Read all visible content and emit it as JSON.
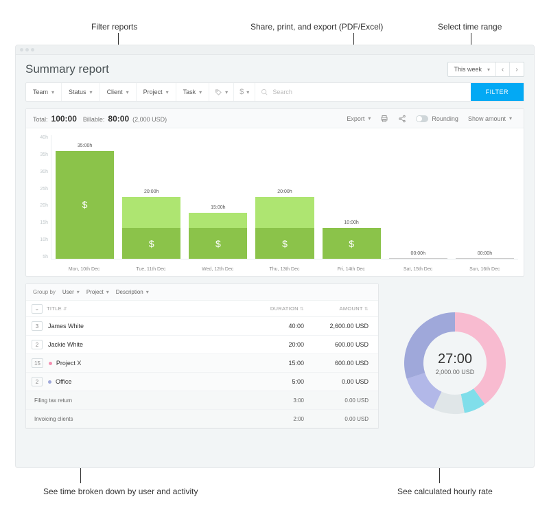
{
  "annotations": {
    "filter": "Filter reports",
    "share": "Share, print, and export (PDF/Excel)",
    "time": "Select time range",
    "breakdown": "See time broken down by user and activity",
    "rate": "See calculated hourly rate"
  },
  "header": {
    "title": "Summary report",
    "time_range": "This week"
  },
  "filters": {
    "team": "Team",
    "status": "Status",
    "client": "Client",
    "project": "Project",
    "task": "Task",
    "search_placeholder": "Search",
    "button": "FILTER"
  },
  "toolbar": {
    "total_label": "Total:",
    "total_value": "100:00",
    "billable_label": "Billable:",
    "billable_value": "80:00",
    "billable_amount": "(2,000 USD)",
    "export": "Export",
    "rounding": "Rounding",
    "show_amount": "Show amount"
  },
  "chart_data": {
    "type": "bar",
    "ylabel_suffix": "h",
    "y_ticks": [
      "40h",
      "35h",
      "30h",
      "25h",
      "20h",
      "15h",
      "10h",
      "5h"
    ],
    "ylim": [
      0,
      40
    ],
    "categories": [
      "Mon, 10th Dec",
      "Tue, 11th Dec",
      "Wed, 12th Dec",
      "Thu, 13th Dec",
      "Fri, 14th Dec",
      "Sat, 15th Dec",
      "Sun, 16th Dec"
    ],
    "series": [
      {
        "name": "non-billable",
        "color": "#aee571",
        "values": [
          0,
          10,
          5,
          10,
          0,
          0,
          0
        ]
      },
      {
        "name": "billable",
        "color": "#8bc34a",
        "values": [
          35,
          10,
          10,
          10,
          10,
          0,
          0
        ]
      }
    ],
    "bar_labels": [
      "35:00h",
      "20:00h",
      "15:00h",
      "20:00h",
      "10:00h",
      "00:00h",
      "00:00h"
    ]
  },
  "grouping": {
    "label": "Group by",
    "g1": "User",
    "g2": "Project",
    "g3": "Description"
  },
  "table": {
    "headers": {
      "title": "TITLE",
      "duration": "DURATION",
      "amount": "AMOUNT"
    },
    "rows": [
      {
        "type": "user",
        "badge": "3",
        "title": "James White",
        "duration": "40:00",
        "amount": "2,600.00 USD"
      },
      {
        "type": "user",
        "badge": "2",
        "title": "Jackie White",
        "duration": "20:00",
        "amount": "600.00 USD"
      },
      {
        "type": "project",
        "badge": "15",
        "dot": "#f48fb1",
        "title": "Project X",
        "duration": "15:00",
        "amount": "600.00 USD"
      },
      {
        "type": "project",
        "badge": "2",
        "dot": "#9fa8da",
        "title": "Office",
        "duration": "5:00",
        "amount": "0.00 USD"
      },
      {
        "type": "desc",
        "title": "Filing tax return",
        "duration": "3:00",
        "amount": "0.00 USD"
      },
      {
        "type": "desc",
        "title": "Invoicing clients",
        "duration": "2:00",
        "amount": "0.00 USD"
      }
    ]
  },
  "donut": {
    "time": "27:00",
    "amount": "2,000.00 USD",
    "segments": [
      {
        "color": "#f8bbd0",
        "pct": 40
      },
      {
        "color": "#80deea",
        "pct": 7
      },
      {
        "color": "#e0e6e8",
        "pct": 10
      },
      {
        "color": "#b2b8e8",
        "pct": 13
      },
      {
        "color": "#9fa8da",
        "pct": 30
      }
    ]
  }
}
